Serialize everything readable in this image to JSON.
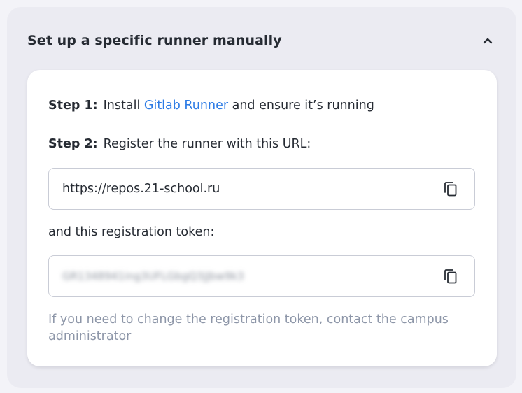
{
  "section": {
    "title": "Set up a specific runner manually"
  },
  "icons": {
    "collapse": "chevron-up-icon",
    "copy": "copy-icon"
  },
  "steps": {
    "step1": {
      "label": "Step 1:",
      "prefix": "Install ",
      "link_text": "Gitlab Runner",
      "suffix": " and ensure it’s running"
    },
    "step2": {
      "label": "Step 2:",
      "text": "Register the runner with this URL:"
    }
  },
  "url_field": {
    "value": "https://repos.21-school.ru"
  },
  "token": {
    "label": "and this registration token:",
    "value": "GR1348941ing3UFLGbgQ3jJbw9k3"
  },
  "hint": "If you need to change the registration token, contact the campus administrator",
  "colors": {
    "link": "#2c7be5",
    "hint": "#8d96a8",
    "text": "#262b33"
  }
}
